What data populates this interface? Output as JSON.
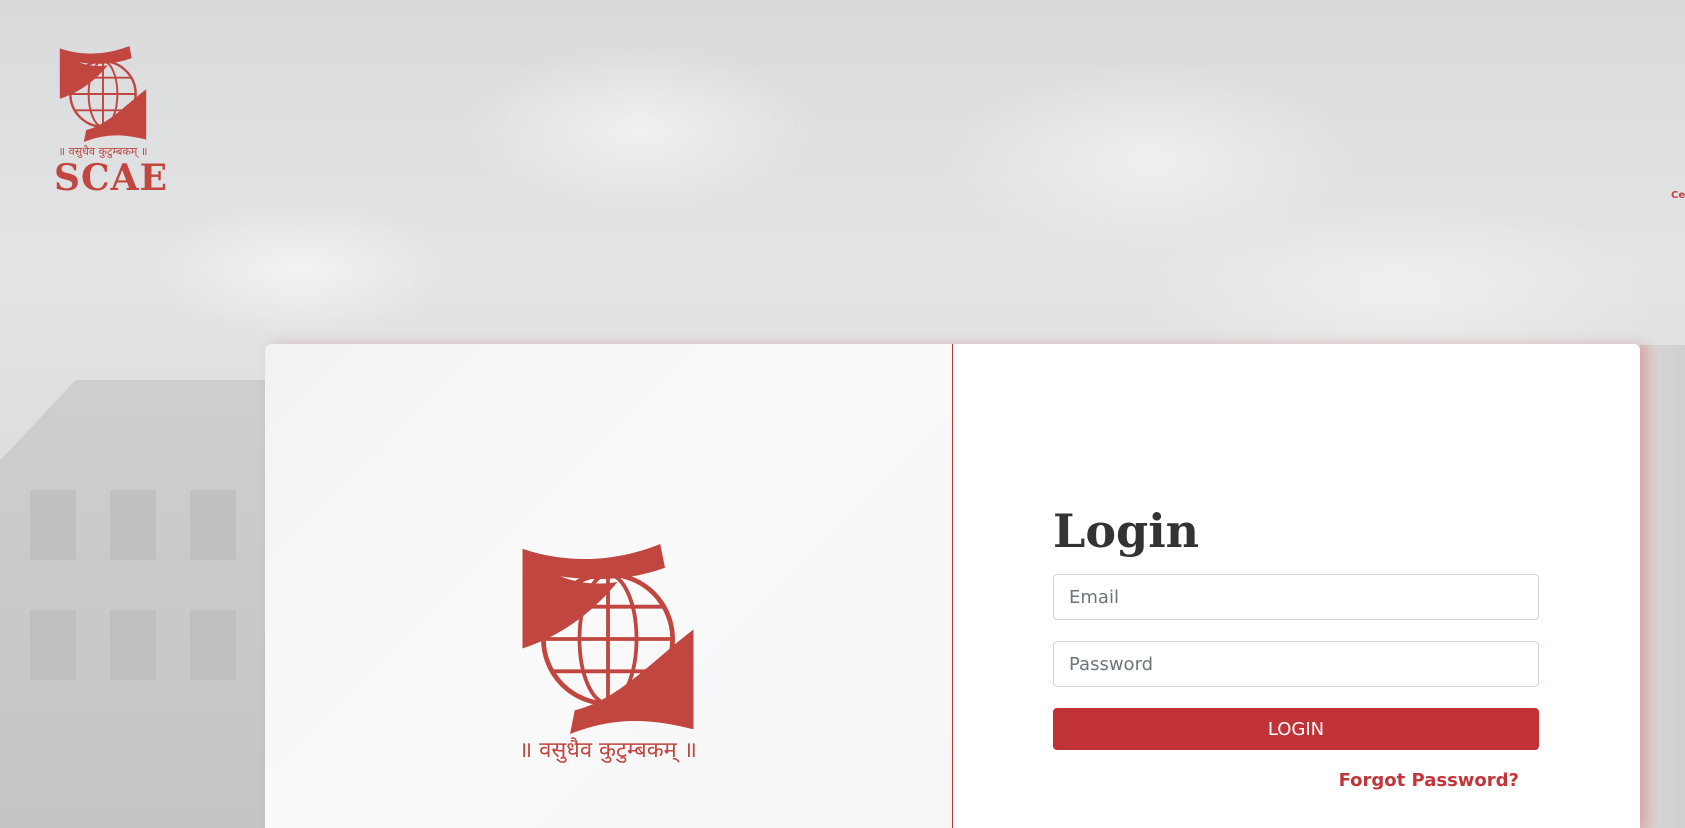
{
  "header": {
    "logo_motto": "॥ वसुधैव कुटुम्बकम् ॥",
    "logo_brand": "SCAE",
    "edge_text": "Ce"
  },
  "illustration": {
    "motto": "॥ वसुधैव कुटुम्बकम् ॥"
  },
  "login": {
    "title": "Login",
    "email_placeholder": "Email",
    "email_value": "",
    "password_placeholder": "Password",
    "password_value": "",
    "submit_label": "LOGIN",
    "forgot_label": "Forgot Password?"
  },
  "colors": {
    "brand": "#c0463f",
    "button": "#c13236",
    "title_text": "#333333"
  }
}
